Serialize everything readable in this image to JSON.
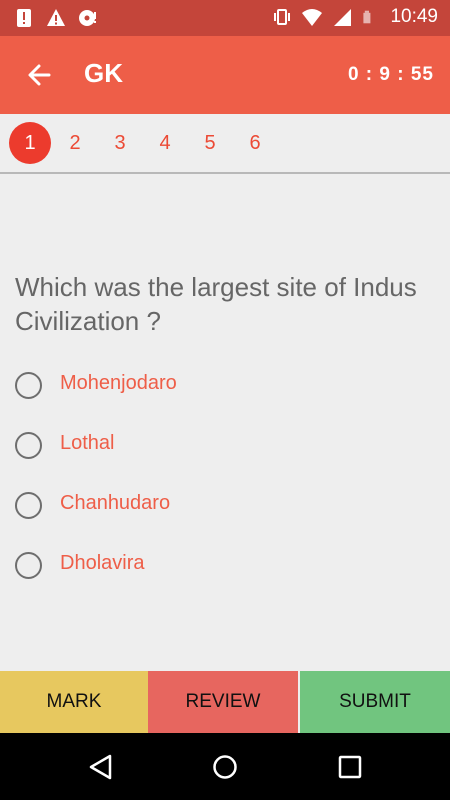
{
  "status_bar": {
    "time": "10:49"
  },
  "app_bar": {
    "title": "GK",
    "timer": "0 : 9 : 55"
  },
  "question_nav": {
    "tabs": [
      "1",
      "2",
      "3",
      "4",
      "5",
      "6"
    ],
    "active_index": 0
  },
  "question": {
    "text": "Which was the largest site of Indus Civilization ?",
    "options": [
      "Mohenjodaro",
      "Lothal",
      "Chanhudaro",
      "Dholavira"
    ]
  },
  "actions": {
    "mark": "MARK",
    "review": "REVIEW",
    "submit": "SUBMIT"
  },
  "colors": {
    "status_bar": "#c4453a",
    "app_bar": "#ee5e48",
    "accent": "#ec3b2d",
    "mark": "#e7c85f",
    "review": "#e7665f",
    "submit": "#71c57f"
  }
}
